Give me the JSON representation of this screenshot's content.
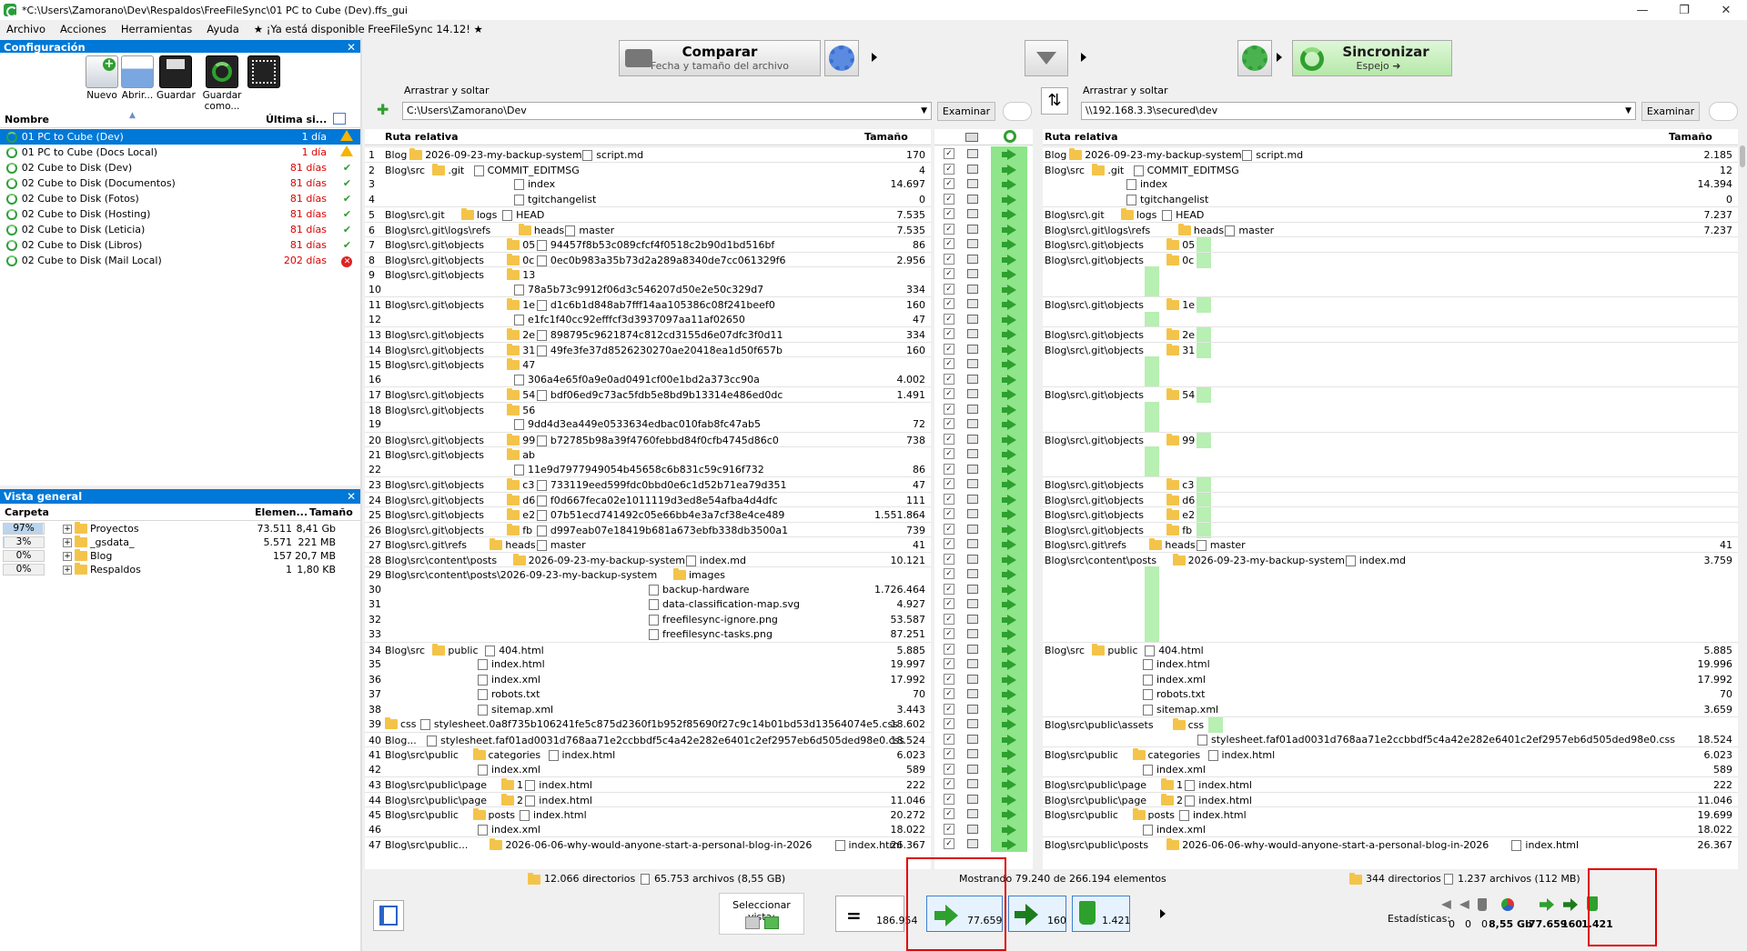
{
  "window": {
    "title": "*C:\\Users\\Zamorano\\Dev\\Respaldos\\FreeFileSync\\01 PC to Cube (Dev).ffs_gui"
  },
  "menu": [
    "Archivo",
    "Acciones",
    "Herramientas",
    "Ayuda",
    "★ ¡Ya está disponible FreeFileSync 14.12! ★"
  ],
  "config_panel": {
    "title": "Configuración",
    "buttons": [
      "Nuevo",
      "Abrir...",
      "Guardar",
      "Guardar como..."
    ],
    "col_name": "Nombre",
    "col_last": "Última si...",
    "items": [
      {
        "name": "01 PC to Cube (Dev)",
        "days": "1 día",
        "status": "warning",
        "selected": true
      },
      {
        "name": "01 PC to Cube (Docs Local)",
        "days": "1 día",
        "status": "warning"
      },
      {
        "name": "02 Cube to Disk (Dev)",
        "days": "81 días",
        "status": "ok"
      },
      {
        "name": "02 Cube to Disk (Documentos)",
        "days": "81 días",
        "status": "ok"
      },
      {
        "name": "02 Cube to Disk (Fotos)",
        "days": "81 días",
        "status": "ok"
      },
      {
        "name": "02 Cube to Disk (Hosting)",
        "days": "81 días",
        "status": "ok"
      },
      {
        "name": "02 Cube to Disk (Leticia)",
        "days": "81 días",
        "status": "ok"
      },
      {
        "name": "02 Cube to Disk (Libros)",
        "days": "81 días",
        "status": "ok"
      },
      {
        "name": "02 Cube to Disk (Mail Local)",
        "days": "202 días",
        "status": "error"
      }
    ]
  },
  "overview": {
    "title": "Vista general",
    "col_folder": "Carpeta",
    "col_items": "Elemen...",
    "col_size": "Tamaño",
    "rows": [
      {
        "pct": "97%",
        "pct_value": 0.97,
        "name": "Proyectos",
        "items": "73.511",
        "size": "8,41 Gb"
      },
      {
        "pct": "3%",
        "pct_value": 0.03,
        "name": "_gsdata_",
        "items": "5.571",
        "size": "221 MB"
      },
      {
        "pct": "0%",
        "pct_value": 0,
        "name": "Blog",
        "items": "157",
        "size": "20,7 MB"
      },
      {
        "pct": "0%",
        "pct_value": 0,
        "name": "Respaldos",
        "items": "1",
        "size": "1,80 KB"
      }
    ]
  },
  "toolbar": {
    "compare_label": "Comparar",
    "compare_sub": "Fecha y tamaño del archivo",
    "sync_label": "Sincronizar",
    "sync_sub": "Espejo ➜"
  },
  "left_path": {
    "label": "Arrastrar y soltar",
    "value": "C:\\Users\\Zamorano\\Dev",
    "browse": "Examinar"
  },
  "right_path": {
    "label": "Arrastrar y soltar",
    "value": "\\\\192.168.3.3\\secured\\dev",
    "browse": "Examinar"
  },
  "grid_headers": {
    "left_path": "Ruta relativa",
    "left_size": "Tamaño",
    "right_path": "Ruta relativa",
    "right_size": "Tamaño"
  },
  "rows": [
    {
      "n": "1",
      "lp": "Blog",
      "lf": "2026-09-23-my-backup-system",
      "lfile": "script.md",
      "ls": "170",
      "rp": "Blog",
      "rf": "2026-09-23-my-backup-system",
      "rfile": "script.md",
      "rs": "2.185"
    },
    {
      "n": "2",
      "lp": "Blog\\src",
      "lf": ".git",
      "lfile": "COMMIT_EDITMSG",
      "ls": "4",
      "rp": "Blog\\src",
      "rf": ".git",
      "rfile": "COMMIT_EDITMSG",
      "rs": "12"
    },
    {
      "n": "3",
      "lp": "",
      "lf": "",
      "lfile": "index",
      "ls": "14.697",
      "rp": "",
      "rf": "",
      "rfile": "index",
      "rs": "14.394"
    },
    {
      "n": "4",
      "lp": "",
      "lf": "",
      "lfile": "tgitchangelist",
      "ls": "0",
      "rp": "",
      "rf": "",
      "rfile": "tgitchangelist",
      "rs": "0"
    },
    {
      "n": "5",
      "lp": "Blog\\src\\.git",
      "lf": "logs",
      "lfile": "HEAD",
      "ls": "7.535",
      "rp": "Blog\\src\\.git",
      "rf": "logs",
      "rfile": "HEAD",
      "rs": "7.237"
    },
    {
      "n": "6",
      "lp": "Blog\\src\\.git\\logs\\refs",
      "lf": "heads",
      "lfile": "master",
      "ls": "7.535",
      "rp": "Blog\\src\\.git\\logs\\refs",
      "rf": "heads",
      "rfile": "master",
      "rs": "7.237"
    },
    {
      "n": "7",
      "lp": "Blog\\src\\.git\\objects",
      "lf": "05",
      "lfile": "94457f8b53c089cfcf4f0518c2b90d1bd516bf",
      "ls": "86",
      "rp": "Blog\\src\\.git\\objects",
      "rf": "05",
      "rfile": "",
      "rs": ""
    },
    {
      "n": "8",
      "lp": "Blog\\src\\.git\\objects",
      "lf": "0c",
      "lfile": "0ec0b983a35b73d2a289a8340de7cc061329f6",
      "ls": "2.956",
      "rp": "Blog\\src\\.git\\objects",
      "rf": "0c",
      "rfile": "",
      "rs": ""
    },
    {
      "n": "9",
      "lp": "Blog\\src\\.git\\objects",
      "lf": "13",
      "lfile": "",
      "ls": "",
      "rp": "",
      "rf": "",
      "rfile": "",
      "rs": ""
    },
    {
      "n": "10",
      "lp": "",
      "lf": "",
      "lfile": "78a5b73c9912f06d3c546207d50e2e50c329d7",
      "ls": "334",
      "rp": "",
      "rf": "",
      "rfile": "",
      "rs": ""
    },
    {
      "n": "11",
      "lp": "Blog\\src\\.git\\objects",
      "lf": "1e",
      "lfile": "d1c6b1d848ab7fff14aa105386c08f241beef0",
      "ls": "160",
      "rp": "Blog\\src\\.git\\objects",
      "rf": "1e",
      "rfile": "",
      "rs": ""
    },
    {
      "n": "12",
      "lp": "",
      "lf": "",
      "lfile": "e1fc1f40cc92efffcf3d3937097aa11af02650",
      "ls": "47",
      "rp": "",
      "rf": "",
      "rfile": "",
      "rs": ""
    },
    {
      "n": "13",
      "lp": "Blog\\src\\.git\\objects",
      "lf": "2e",
      "lfile": "898795c9621874c812cd3155d6e07dfc3f0d11",
      "ls": "334",
      "rp": "Blog\\src\\.git\\objects",
      "rf": "2e",
      "rfile": "",
      "rs": ""
    },
    {
      "n": "14",
      "lp": "Blog\\src\\.git\\objects",
      "lf": "31",
      "lfile": "49fe3fe37d8526230270ae20418ea1d50f657b",
      "ls": "160",
      "rp": "Blog\\src\\.git\\objects",
      "rf": "31",
      "rfile": "",
      "rs": ""
    },
    {
      "n": "15",
      "lp": "Blog\\src\\.git\\objects",
      "lf": "47",
      "lfile": "",
      "ls": "",
      "rp": "",
      "rf": "",
      "rfile": "",
      "rs": ""
    },
    {
      "n": "16",
      "lp": "",
      "lf": "",
      "lfile": "306a4e65f0a9e0ad0491cf00e1bd2a373cc90a",
      "ls": "4.002",
      "rp": "",
      "rf": "",
      "rfile": "",
      "rs": ""
    },
    {
      "n": "17",
      "lp": "Blog\\src\\.git\\objects",
      "lf": "54",
      "lfile": "bdf06ed9c73ac5fdb5e8bd9b13314e486ed0dc",
      "ls": "1.491",
      "rp": "Blog\\src\\.git\\objects",
      "rf": "54",
      "rfile": "",
      "rs": ""
    },
    {
      "n": "18",
      "lp": "Blog\\src\\.git\\objects",
      "lf": "56",
      "lfile": "",
      "ls": "",
      "rp": "",
      "rf": "",
      "rfile": "",
      "rs": ""
    },
    {
      "n": "19",
      "lp": "",
      "lf": "",
      "lfile": "9dd4d3ea449e0533634edbac010fab8fc47ab5",
      "ls": "72",
      "rp": "",
      "rf": "",
      "rfile": "",
      "rs": ""
    },
    {
      "n": "20",
      "lp": "Blog\\src\\.git\\objects",
      "lf": "99",
      "lfile": "b72785b98a39f4760febbd84f0cfb4745d86c0",
      "ls": "738",
      "rp": "Blog\\src\\.git\\objects",
      "rf": "99",
      "rfile": "",
      "rs": ""
    },
    {
      "n": "21",
      "lp": "Blog\\src\\.git\\objects",
      "lf": "ab",
      "lfile": "",
      "ls": "",
      "rp": "",
      "rf": "",
      "rfile": "",
      "rs": ""
    },
    {
      "n": "22",
      "lp": "",
      "lf": "",
      "lfile": "11e9d7977949054b45658c6b831c59c916f732",
      "ls": "86",
      "rp": "",
      "rf": "",
      "rfile": "",
      "rs": ""
    },
    {
      "n": "23",
      "lp": "Blog\\src\\.git\\objects",
      "lf": "c3",
      "lfile": "733119eed599fdc0bbd0e6c1d52b71ea79d351",
      "ls": "47",
      "rp": "Blog\\src\\.git\\objects",
      "rf": "c3",
      "rfile": "",
      "rs": ""
    },
    {
      "n": "24",
      "lp": "Blog\\src\\.git\\objects",
      "lf": "d6",
      "lfile": "f0d667feca02e1011119d3ed8e54afba4d4dfc",
      "ls": "111",
      "rp": "Blog\\src\\.git\\objects",
      "rf": "d6",
      "rfile": "",
      "rs": ""
    },
    {
      "n": "25",
      "lp": "Blog\\src\\.git\\objects",
      "lf": "e2",
      "lfile": "07b51ecd741492c05e66bb4e3a7cf38e4ce489",
      "ls": "1.551.864",
      "rp": "Blog\\src\\.git\\objects",
      "rf": "e2",
      "rfile": "",
      "rs": ""
    },
    {
      "n": "26",
      "lp": "Blog\\src\\.git\\objects",
      "lf": "fb",
      "lfile": "d997eab07e18419b681a673ebfb338db3500a1",
      "ls": "739",
      "rp": "Blog\\src\\.git\\objects",
      "rf": "fb",
      "rfile": "",
      "rs": ""
    },
    {
      "n": "27",
      "lp": "Blog\\src\\.git\\refs",
      "lf": "heads",
      "lfile": "master",
      "ls": "41",
      "rp": "Blog\\src\\.git\\refs",
      "rf": "heads",
      "rfile": "master",
      "rs": "41"
    },
    {
      "n": "28",
      "lp": "Blog\\src\\content\\posts",
      "lf": "2026-09-23-my-backup-system",
      "lfile": "index.md",
      "ls": "10.121",
      "rp": "Blog\\src\\content\\posts",
      "rf": "2026-09-23-my-backup-system",
      "rfile": "index.md",
      "rs": "3.759"
    },
    {
      "n": "29",
      "lp": "Blog\\src\\content\\posts\\2026-09-23-my-backup-system",
      "lf": "images",
      "lfile": "",
      "ls": "",
      "rp": "",
      "rf": "",
      "rfile": "",
      "rs": ""
    },
    {
      "n": "30",
      "lp": "",
      "lf": "",
      "lfile": "backup-hardware",
      "ls": "1.726.464",
      "rp": "",
      "rf": "",
      "rfile": "",
      "rs": ""
    },
    {
      "n": "31",
      "lp": "",
      "lf": "",
      "lfile": "data-classification-map.svg",
      "ls": "4.927",
      "rp": "",
      "rf": "",
      "rfile": "",
      "rs": ""
    },
    {
      "n": "32",
      "lp": "",
      "lf": "",
      "lfile": "freefilesync-ignore.png",
      "ls": "53.587",
      "rp": "",
      "rf": "",
      "rfile": "",
      "rs": ""
    },
    {
      "n": "33",
      "lp": "",
      "lf": "",
      "lfile": "freefilesync-tasks.png",
      "ls": "87.251",
      "rp": "",
      "rf": "",
      "rfile": "",
      "rs": ""
    },
    {
      "n": "34",
      "lp": "Blog\\src",
      "lf": "public",
      "lfile": "404.html",
      "ls": "5.885",
      "rp": "Blog\\src",
      "rf": "public",
      "rfile": "404.html",
      "rs": "5.885"
    },
    {
      "n": "35",
      "lp": "",
      "lf": "",
      "lfile": "index.html",
      "ls": "19.997",
      "rp": "",
      "rf": "",
      "rfile": "index.html",
      "rs": "19.996"
    },
    {
      "n": "36",
      "lp": "",
      "lf": "",
      "lfile": "index.xml",
      "ls": "17.992",
      "rp": "",
      "rf": "",
      "rfile": "index.xml",
      "rs": "17.992"
    },
    {
      "n": "37",
      "lp": "",
      "lf": "",
      "lfile": "robots.txt",
      "ls": "70",
      "rp": "",
      "rf": "",
      "rfile": "robots.txt",
      "rs": "70"
    },
    {
      "n": "38",
      "lp": "",
      "lf": "",
      "lfile": "sitemap.xml",
      "ls": "3.443",
      "rp": "",
      "rf": "",
      "rfile": "sitemap.xml",
      "rs": "3.659"
    },
    {
      "n": "39",
      "lp": "",
      "lf": "css",
      "lfile": "stylesheet.0a8f735b106241fe5c875d2360f1b952f85690f27c9c14b01bd53d13564074e5.css",
      "ls": "18.602",
      "rp": "Blog\\src\\public\\assets",
      "rf": "css",
      "rfile": "",
      "rs": ""
    },
    {
      "n": "40",
      "lp": "Blog...",
      "lf": "",
      "lfile": "stylesheet.faf01ad0031d768aa71e2ccbbdf5c4a42e282e6401c2ef2957eb6d505ded98e0.css",
      "ls": "18.524",
      "rp": "",
      "rf": "",
      "rfile": "stylesheet.faf01ad0031d768aa71e2ccbbdf5c4a42e282e6401c2ef2957eb6d505ded98e0.css",
      "rs": "18.524"
    },
    {
      "n": "41",
      "lp": "Blog\\src\\public",
      "lf": "categories",
      "lfile": "index.html",
      "ls": "6.023",
      "rp": "Blog\\src\\public",
      "rf": "categories",
      "rfile": "index.html",
      "rs": "6.023"
    },
    {
      "n": "42",
      "lp": "",
      "lf": "",
      "lfile": "index.xml",
      "ls": "589",
      "rp": "",
      "rf": "",
      "rfile": "index.xml",
      "rs": "589"
    },
    {
      "n": "43",
      "lp": "Blog\\src\\public\\page",
      "lf": "1",
      "lfile": "index.html",
      "ls": "222",
      "rp": "Blog\\src\\public\\page",
      "rf": "1",
      "rfile": "index.html",
      "rs": "222"
    },
    {
      "n": "44",
      "lp": "Blog\\src\\public\\page",
      "lf": "2",
      "lfile": "index.html",
      "ls": "11.046",
      "rp": "Blog\\src\\public\\page",
      "rf": "2",
      "rfile": "index.html",
      "rs": "11.046"
    },
    {
      "n": "45",
      "lp": "Blog\\src\\public",
      "lf": "posts",
      "lfile": "index.html",
      "ls": "20.272",
      "rp": "Blog\\src\\public",
      "rf": "posts",
      "rfile": "index.html",
      "rs": "19.699"
    },
    {
      "n": "46",
      "lp": "",
      "lf": "",
      "lfile": "index.xml",
      "ls": "18.022",
      "rp": "",
      "rf": "",
      "rfile": "index.xml",
      "rs": "18.022"
    },
    {
      "n": "47",
      "lp": "Blog\\src\\public...",
      "lf": "2026-06-06-why-would-anyone-start-a-personal-blog-in-2026",
      "lfile": "index.html",
      "ls": "26.367",
      "rp": "Blog\\src\\public\\posts",
      "rf": "2026-06-06-why-would-anyone-start-a-personal-blog-in-2026",
      "rfile": "index.html",
      "rs": "26.367"
    }
  ],
  "status_left": {
    "dirs": "12.066 directorios",
    "files": "65.753 archivos (8,55 GB)"
  },
  "status_mid": "Mostrando 79.240 de 266.194 elementos",
  "status_right": {
    "dirs": "344 directorios",
    "files": "1.237 archivos (112 MB)"
  },
  "bottom": {
    "select_view": "Seleccionar vista:",
    "equal_count": "186.954",
    "create_right": "77.659",
    "update_right": "160",
    "delete_right": "1.421",
    "stats_label": "Estadísticas:",
    "stats_left_create": "0",
    "stats_left_update": "0",
    "stats_left_delete": "0",
    "stats_size": "8,55 Gb",
    "stats_right_create": "77.659",
    "stats_right_update": "160",
    "stats_right_delete": "1.421"
  },
  "colors": {
    "accent": "#0078d7",
    "green": "#2ea02e",
    "highlight_box": "#e00000"
  }
}
